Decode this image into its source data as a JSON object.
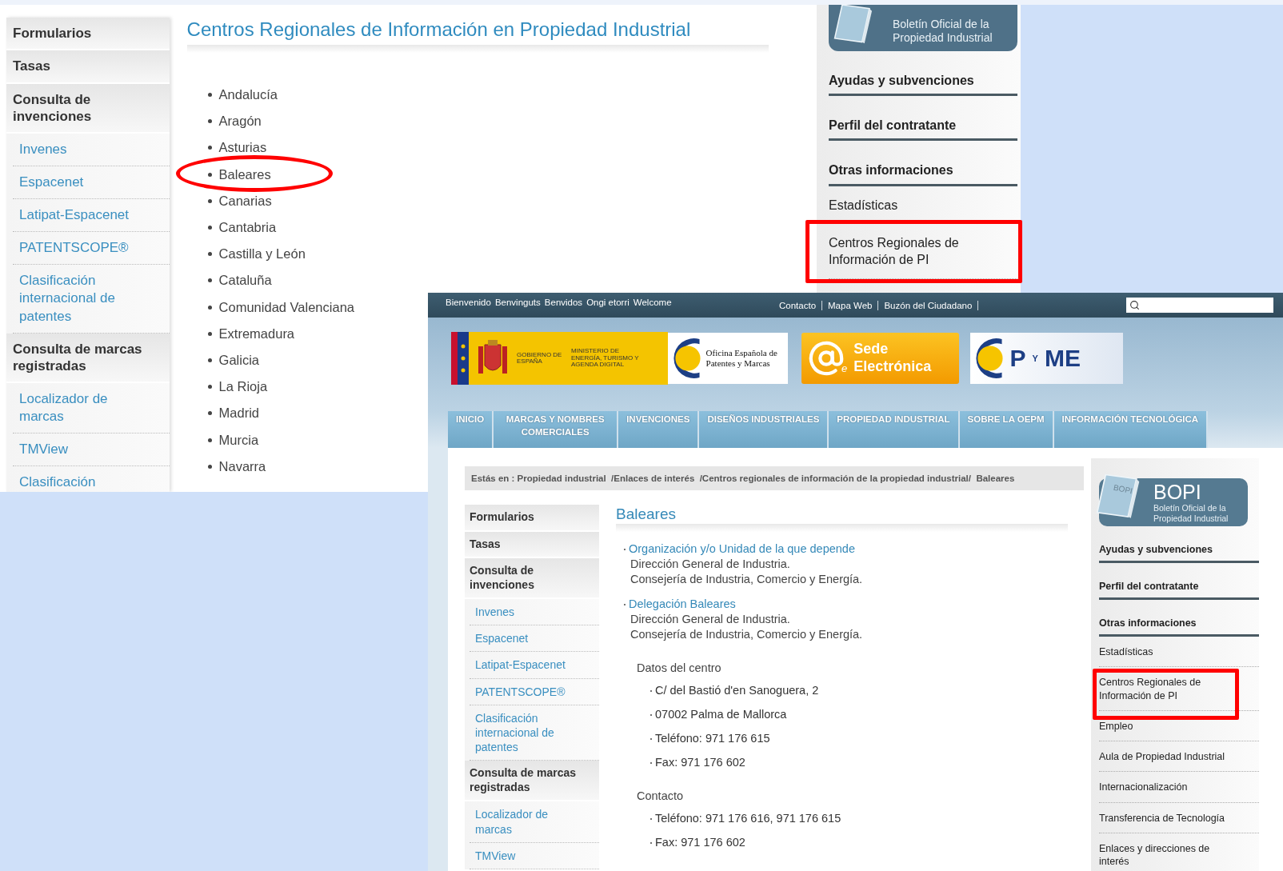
{
  "screenshot_1": {
    "left_menu": [
      {
        "kind": "heading",
        "label": "Formularios"
      },
      {
        "kind": "heading",
        "label": "Tasas"
      },
      {
        "kind": "heading",
        "label": "Consulta de invenciones"
      },
      {
        "kind": "link",
        "label": "Invenes"
      },
      {
        "kind": "link",
        "label": "Espacenet"
      },
      {
        "kind": "link",
        "label": "Latipat-Espacenet"
      },
      {
        "kind": "link",
        "label": "PATENTSCOPE®"
      },
      {
        "kind": "link",
        "label": "Clasificación internacional de patentes"
      },
      {
        "kind": "heading",
        "label": "Consulta de marcas registradas"
      },
      {
        "kind": "link",
        "label": "Localizador de marcas"
      },
      {
        "kind": "link",
        "label": "TMView"
      },
      {
        "kind": "link",
        "label": "Clasificación"
      }
    ],
    "page_title": "Centros Regionales de Información en Propiedad Industrial",
    "regions": [
      "Andalucía",
      "Aragón",
      "Asturias",
      "Baleares",
      "Canarias",
      "Cantabria",
      "Castilla y León",
      "Cataluña",
      "Comunidad Valenciana",
      "Extremadura",
      "Galicia",
      "La Rioja",
      "Madrid",
      "Murcia",
      "Navarra"
    ],
    "bopi_logo": {
      "subtitle": "Boletín Oficial de la Propiedad Industrial"
    },
    "right_menu": [
      {
        "kind": "heading",
        "label": "Ayudas y subvenciones"
      },
      {
        "kind": "heading",
        "label": "Perfil del contratante"
      },
      {
        "kind": "heading",
        "label": "Otras informaciones"
      },
      {
        "kind": "link",
        "label": "Estadísticas"
      },
      {
        "kind": "link",
        "label": "Centros Regionales de Información de PI"
      }
    ]
  },
  "screenshot_2": {
    "greetings": [
      "Bienvenido",
      "Benvinguts",
      "Benvidos",
      "Ongi etorri",
      "Welcome"
    ],
    "top_links": [
      "Contacto",
      "Mapa Web",
      "Buzón del Ciudadano"
    ],
    "logos": {
      "government": "GOBIERNO DE ESPAÑA",
      "ministry": "MINISTERIO DE ENERGÍA, TURISMO Y AGENDA DIGITAL",
      "oepm": "Oficina Española de Patentes y Marcas",
      "sede": "Sede Electrónica",
      "sede_mark": "e",
      "pyme": [
        "P",
        "Y",
        "ME"
      ]
    },
    "nav": [
      "INICIO",
      "MARCAS Y NOMBRES COMERCIALES",
      "INVENCIONES",
      "DISEÑOS INDUSTRIALES",
      "PROPIEDAD INDUSTRIAL",
      "SOBRE LA OEPM",
      "INFORMACIÓN TECNOLÓGICA"
    ],
    "breadcrumb": "Estás en : Propiedad industrial  /Enlaces de interés  /Centros regionales de información de la propiedad industrial/  Baleares",
    "left_menu": [
      {
        "kind": "heading",
        "label": "Formularios"
      },
      {
        "kind": "heading",
        "label": "Tasas"
      },
      {
        "kind": "heading",
        "label": "Consulta de invenciones"
      },
      {
        "kind": "link",
        "label": "Invenes"
      },
      {
        "kind": "link",
        "label": "Espacenet"
      },
      {
        "kind": "link",
        "label": "Latipat-Espacenet"
      },
      {
        "kind": "link",
        "label": "PATENTSCOPE®"
      },
      {
        "kind": "link",
        "label": "Clasificación internacional de patentes"
      },
      {
        "kind": "heading",
        "label": "Consulta de marcas registradas"
      },
      {
        "kind": "link",
        "label": "Localizador de marcas"
      },
      {
        "kind": "link",
        "label": "TMView"
      }
    ],
    "page_title": "Baleares",
    "entries": [
      {
        "title": "Organización y/o Unidad de la que depende",
        "lines": [
          "Dirección General de Industria.",
          "Consejería de Industria, Comercio y Energía."
        ]
      },
      {
        "title": "Delegación Baleares",
        "lines": [
          "Dirección General de Industria.",
          "Consejería de Industria, Comercio y Energía."
        ]
      }
    ],
    "sections": [
      {
        "heading": "Datos del centro",
        "items": [
          "C/ del Bastió d'en Sanoguera, 2",
          "07002 Palma de Mallorca",
          "Teléfono: 971 176 615",
          "Fax: 971 176 602"
        ]
      },
      {
        "heading": "Contacto",
        "items": [
          "Teléfono: 971 176 616, 971 176 615",
          "Fax: 971 176 602"
        ]
      }
    ],
    "bopi_logo": {
      "title": "BOPI",
      "cover": "BOPI",
      "subtitle": "Boletín Oficial de la Propiedad Industrial"
    },
    "right_menu": [
      {
        "kind": "heading",
        "label": "Ayudas y subvenciones"
      },
      {
        "kind": "heading",
        "label": "Perfil del contratante"
      },
      {
        "kind": "heading",
        "label": "Otras informaciones"
      },
      {
        "kind": "link",
        "label": "Estadísticas"
      },
      {
        "kind": "link",
        "label": "Centros Regionales de Información de PI"
      },
      {
        "kind": "link",
        "label": "Empleo"
      },
      {
        "kind": "link",
        "label": "Aula de Propiedad Industrial"
      },
      {
        "kind": "link",
        "label": "Internacionalización"
      },
      {
        "kind": "link",
        "label": "Transferencia de Tecnología"
      },
      {
        "kind": "link",
        "label": "Enlaces y direcciones de interés"
      }
    ]
  },
  "annotations": [
    {
      "kind": "ellipse"
    },
    {
      "kind": "rectangle"
    },
    {
      "kind": "rectangle"
    }
  ]
}
